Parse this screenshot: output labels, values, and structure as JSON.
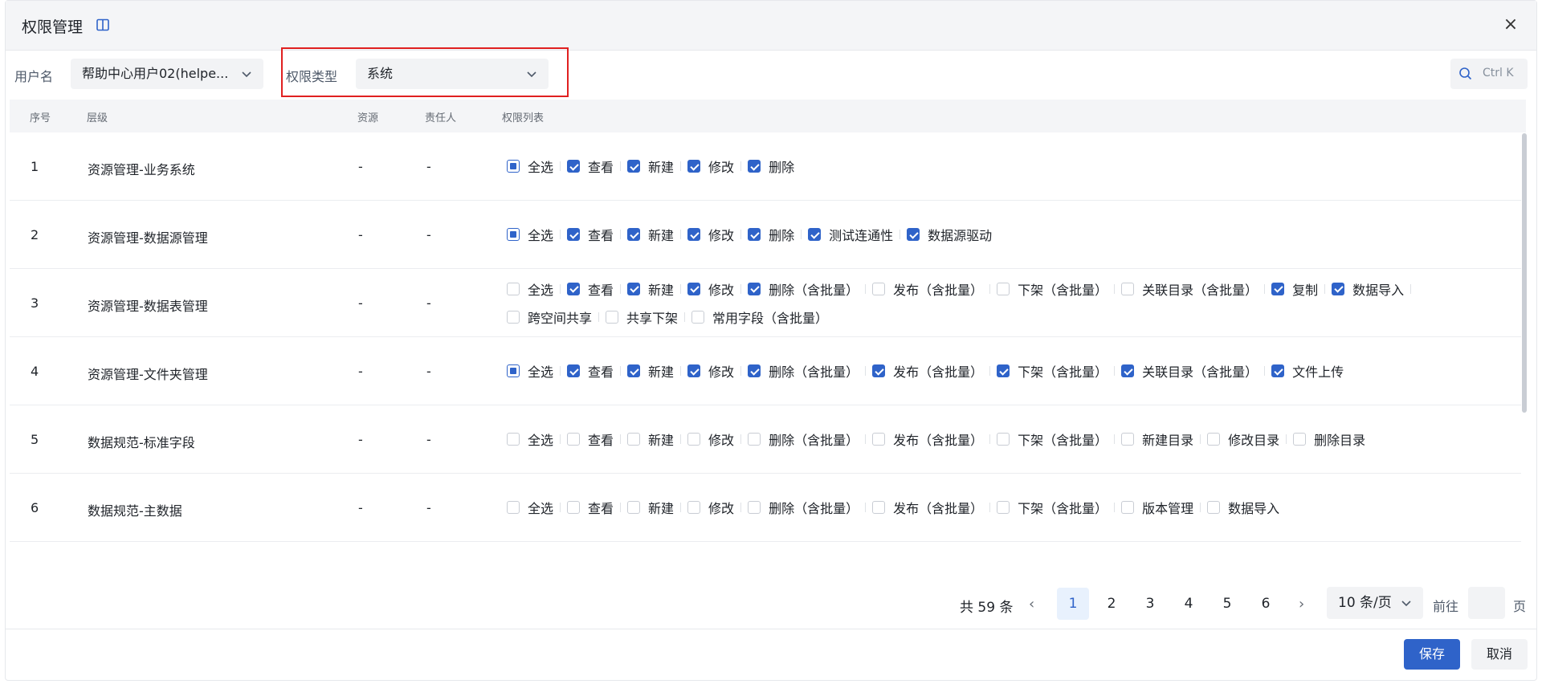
{
  "dialog": {
    "title": "权限管理",
    "close_icon": "close-icon",
    "info_icon": "book-icon"
  },
  "filters": {
    "username_label": "用户名",
    "username_value": "帮助中心用户02(helpe...",
    "perm_type_label": "权限类型",
    "perm_type_value": "系统",
    "search_placeholder": "Ctrl K"
  },
  "table": {
    "columns": [
      "序号",
      "层级",
      "资源",
      "责任人",
      "权限列表"
    ],
    "rows": [
      {
        "no": "1",
        "level": "资源管理-业务系统",
        "resource": "-",
        "owner": "-",
        "perms": [
          {
            "label": "全选",
            "state": "partial"
          },
          {
            "label": "查看",
            "state": "checked"
          },
          {
            "label": "新建",
            "state": "checked"
          },
          {
            "label": "修改",
            "state": "checked"
          },
          {
            "label": "删除",
            "state": "checked"
          }
        ]
      },
      {
        "no": "2",
        "level": "资源管理-数据源管理",
        "resource": "-",
        "owner": "-",
        "perms": [
          {
            "label": "全选",
            "state": "partial"
          },
          {
            "label": "查看",
            "state": "checked"
          },
          {
            "label": "新建",
            "state": "checked"
          },
          {
            "label": "修改",
            "state": "checked"
          },
          {
            "label": "删除",
            "state": "checked"
          },
          {
            "label": "测试连通性",
            "state": "checked"
          },
          {
            "label": "数据源驱动",
            "state": "checked"
          }
        ]
      },
      {
        "no": "3",
        "level": "资源管理-数据表管理",
        "resource": "-",
        "owner": "-",
        "perms": [
          {
            "label": "全选",
            "state": "unchecked"
          },
          {
            "label": "查看",
            "state": "checked"
          },
          {
            "label": "新建",
            "state": "checked"
          },
          {
            "label": "修改",
            "state": "checked"
          },
          {
            "label": "删除（含批量）",
            "state": "checked"
          },
          {
            "label": "发布（含批量）",
            "state": "unchecked"
          },
          {
            "label": "下架（含批量）",
            "state": "unchecked"
          },
          {
            "label": "关联目录（含批量）",
            "state": "unchecked"
          },
          {
            "label": "复制",
            "state": "checked"
          },
          {
            "label": "数据导入",
            "state": "checked"
          },
          {
            "label": "跨空间共享",
            "state": "unchecked"
          },
          {
            "label": "共享下架",
            "state": "unchecked"
          },
          {
            "label": "常用字段（含批量）",
            "state": "unchecked"
          }
        ]
      },
      {
        "no": "4",
        "level": "资源管理-文件夹管理",
        "resource": "-",
        "owner": "-",
        "perms": [
          {
            "label": "全选",
            "state": "partial"
          },
          {
            "label": "查看",
            "state": "checked"
          },
          {
            "label": "新建",
            "state": "checked"
          },
          {
            "label": "修改",
            "state": "checked"
          },
          {
            "label": "删除（含批量）",
            "state": "checked"
          },
          {
            "label": "发布（含批量）",
            "state": "checked"
          },
          {
            "label": "下架（含批量）",
            "state": "checked"
          },
          {
            "label": "关联目录（含批量）",
            "state": "checked"
          },
          {
            "label": "文件上传",
            "state": "checked"
          }
        ]
      },
      {
        "no": "5",
        "level": "数据规范-标准字段",
        "resource": "-",
        "owner": "-",
        "perms": [
          {
            "label": "全选",
            "state": "unchecked"
          },
          {
            "label": "查看",
            "state": "unchecked"
          },
          {
            "label": "新建",
            "state": "unchecked"
          },
          {
            "label": "修改",
            "state": "unchecked"
          },
          {
            "label": "删除（含批量）",
            "state": "unchecked"
          },
          {
            "label": "发布（含批量）",
            "state": "unchecked"
          },
          {
            "label": "下架（含批量）",
            "state": "unchecked"
          },
          {
            "label": "新建目录",
            "state": "unchecked"
          },
          {
            "label": "修改目录",
            "state": "unchecked"
          },
          {
            "label": "删除目录",
            "state": "unchecked"
          }
        ]
      },
      {
        "no": "6",
        "level": "数据规范-主数据",
        "resource": "-",
        "owner": "-",
        "perms": [
          {
            "label": "全选",
            "state": "unchecked"
          },
          {
            "label": "查看",
            "state": "unchecked"
          },
          {
            "label": "新建",
            "state": "unchecked"
          },
          {
            "label": "修改",
            "state": "unchecked"
          },
          {
            "label": "删除（含批量）",
            "state": "unchecked"
          },
          {
            "label": "发布（含批量）",
            "state": "unchecked"
          },
          {
            "label": "下架（含批量）",
            "state": "unchecked"
          },
          {
            "label": "版本管理",
            "state": "unchecked"
          },
          {
            "label": "数据导入",
            "state": "unchecked"
          }
        ]
      }
    ]
  },
  "pagination": {
    "total": "共 59 条",
    "pages": [
      "1",
      "2",
      "3",
      "4",
      "5",
      "6"
    ],
    "current": "1",
    "page_size": "10 条/页",
    "goto_label": "前往",
    "page_suffix": "页"
  },
  "footer": {
    "save_label": "保存",
    "cancel_label": "取消"
  },
  "colors": {
    "primary": "#2f63c9",
    "highlight_border": "#e02020",
    "header_bg": "#f4f5f7"
  }
}
